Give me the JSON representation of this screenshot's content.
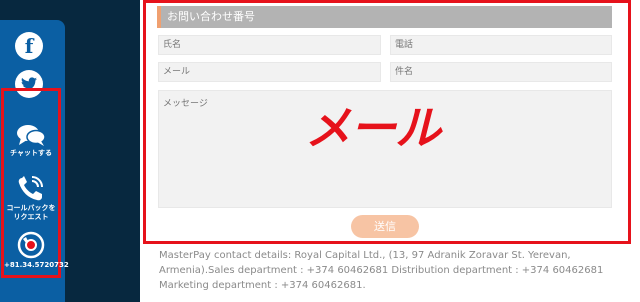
{
  "sidebar": {
    "facebook_icon": "facebook-icon",
    "twitter_icon": "twitter-icon",
    "chat_label": "チャットする",
    "callback_label": "コールバックをリクエスト",
    "phone_label": "+81.34.5720732"
  },
  "form": {
    "header": "お問い合わせ番号",
    "name_placeholder": "氏名",
    "phone_placeholder": "電話",
    "email_placeholder": "メール",
    "subject_placeholder": "件名",
    "message_placeholder": "メッセージ",
    "send_label": "送信"
  },
  "overlay": {
    "text": "メール"
  },
  "footer": {
    "details": "MasterPay contact details: Royal Capital Ltd., (13, 97 Adranik Zoravar St. Yerevan, Armenia).Sales department : +374 60462681 Distribution department : +374 60462681 Marketing department : +374 60462681."
  },
  "colors": {
    "sidebar": "#0b5fa3",
    "background": "#07283f",
    "highlight_border": "#e6121b",
    "send_button": "#f7c4a4"
  }
}
